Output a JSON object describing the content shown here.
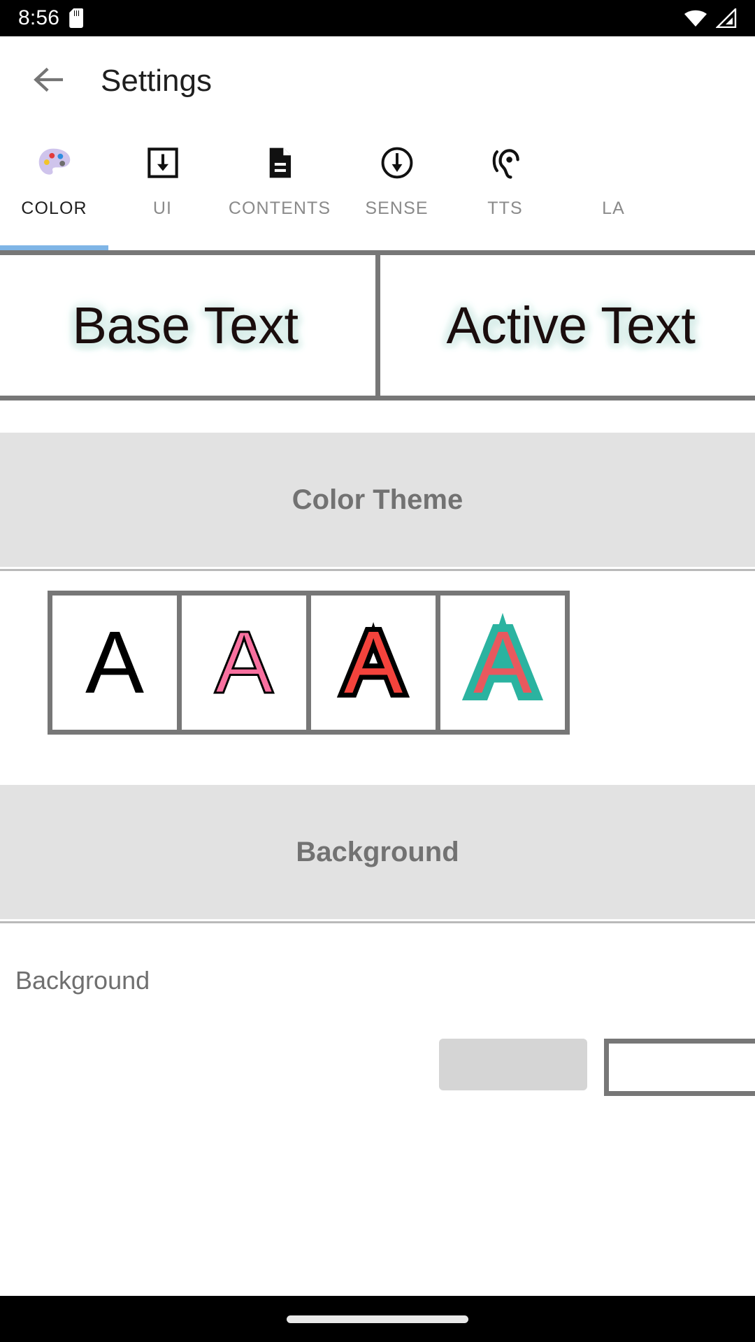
{
  "status_bar": {
    "time": "8:56",
    "sd_icon": "sd-card-icon",
    "wifi_icon": "wifi-icon",
    "signal_icon": "cellular-signal-icon",
    "bg_color": "#000000",
    "fg_color": "#ffffff"
  },
  "app_bar": {
    "back_icon": "back-arrow-icon",
    "title": "Settings",
    "title_color": "#1f1f1f"
  },
  "tabs": {
    "active_index": 0,
    "indicator_color": "#7FB5E6",
    "items": [
      {
        "label": "COLOR",
        "icon": "palette-icon"
      },
      {
        "label": "UI",
        "icon": "box-down-arrow-icon"
      },
      {
        "label": "CONTENTS",
        "icon": "document-icon"
      },
      {
        "label": "SENSE",
        "icon": "circle-down-arrow-icon"
      },
      {
        "label": "TTS",
        "icon": "ear-hearing-icon"
      },
      {
        "label": "LA",
        "icon": "cut-off-icon"
      }
    ]
  },
  "preview": {
    "base_text": "Base Text",
    "active_text": "Active Text",
    "text_color": "#1a0d0d",
    "glow_color": "#d9eeea",
    "frame_color": "#777777"
  },
  "color_theme_section": {
    "title": "Color Theme",
    "header_bg": "#e2e2e2",
    "title_color": "#727272",
    "swatches": [
      {
        "glyph": "A",
        "name": "theme-swatch-black",
        "fill": "#000000",
        "stroke": "none",
        "stroke_width": 0
      },
      {
        "glyph": "A",
        "name": "theme-swatch-pink",
        "fill": "#F8709F",
        "stroke": "#000000",
        "stroke_width": 3
      },
      {
        "glyph": "A",
        "name": "theme-swatch-red",
        "fill": "#F4433C",
        "stroke": "#000000",
        "stroke_width": 14
      },
      {
        "glyph": "A",
        "name": "theme-swatch-teal",
        "fill": "#E8595E",
        "stroke": "#2BB3A0",
        "stroke_width": 22
      }
    ]
  },
  "background_section": {
    "title": "Background",
    "header_bg": "#e2e2e2",
    "title_color": "#727272",
    "row_label": "Background",
    "row_label_color": "#6f6f6f",
    "chip_gray_color": "#d5d5d5",
    "chip_white_color": "#ffffff",
    "chip_border_color": "#777777"
  },
  "nav_bar": {
    "home_pill": "home-indicator-pill",
    "bg_color": "#000000",
    "pill_color": "#e8e8e8"
  }
}
